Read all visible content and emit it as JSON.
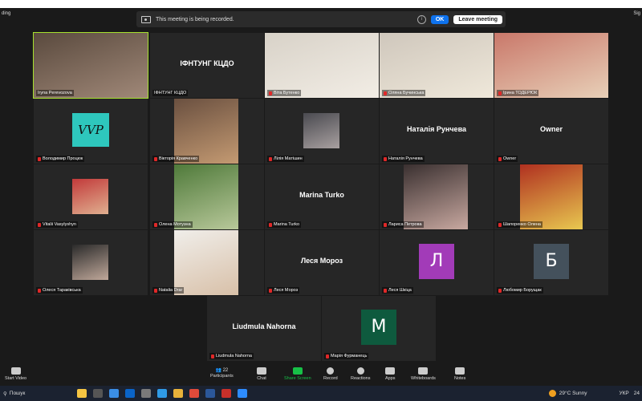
{
  "corner": {
    "left": "ding",
    "right": "Sig"
  },
  "recording": {
    "message": "This meeting is being recorded.",
    "ok": "OK",
    "leave": "Leave meeting"
  },
  "tiles": [
    {
      "name": "Iryna Perevozova",
      "big": "",
      "avatar": "",
      "type": "photo"
    },
    {
      "name": "ІФНТУНГ КЦДО",
      "big": "ІФНТУНГ КЦДО",
      "avatar": "",
      "type": "text"
    },
    {
      "name": "Віта Бутенко",
      "big": "",
      "avatar": "",
      "type": "photo"
    },
    {
      "name": "Оляна Бучинська",
      "big": "",
      "avatar": "",
      "type": "photo"
    },
    {
      "name": "Ірина ТОДЕРЮК",
      "big": "",
      "avatar": "",
      "type": "photo"
    },
    {
      "name": "Володимир Процюк",
      "big": "",
      "avatar": "VVP",
      "type": "logo"
    },
    {
      "name": "Вікторія Кравченко",
      "big": "",
      "avatar": "",
      "type": "photo"
    },
    {
      "name": "Лілія Матішин",
      "big": "",
      "avatar": "",
      "type": "smallphoto"
    },
    {
      "name": "Наталія Рунчева",
      "big": "Наталія Рунчева",
      "avatar": "",
      "type": "text"
    },
    {
      "name": "Owner",
      "big": "Owner",
      "avatar": "",
      "type": "text"
    },
    {
      "name": "Vitalii Vasylyshyn",
      "big": "",
      "avatar": "",
      "type": "smallphoto"
    },
    {
      "name": "Олена Мотузна",
      "big": "",
      "avatar": "",
      "type": "photo"
    },
    {
      "name": "Marina Turko",
      "big": "Marina Turko",
      "avatar": "",
      "type": "text"
    },
    {
      "name": "Лариса Петрова",
      "big": "",
      "avatar": "",
      "type": "photo"
    },
    {
      "name": "Шапоренко Олена",
      "big": "",
      "avatar": "",
      "type": "photo"
    },
    {
      "name": "Олеся Тараківська",
      "big": "",
      "avatar": "",
      "type": "smallphoto"
    },
    {
      "name": "Natalia Drar",
      "big": "",
      "avatar": "",
      "type": "photo"
    },
    {
      "name": "Леся Мороз",
      "big": "Леся Мороз",
      "avatar": "",
      "type": "text"
    },
    {
      "name": "Леся Шкіца",
      "big": "",
      "avatar": "Л",
      "type": "letter",
      "color": "#a23bb8"
    },
    {
      "name": "Любомир Борущак",
      "big": "",
      "avatar": "Б",
      "type": "letter",
      "color": "#44515c"
    },
    {
      "name": "Liudmula Nahorna",
      "big": "Liudmula Nahorna",
      "avatar": "",
      "type": "text"
    },
    {
      "name": "Марія Фурманець",
      "big": "",
      "avatar": "М",
      "type": "letter",
      "color": "#0e5a3e"
    }
  ],
  "toolbar": {
    "start_video": "Start Video",
    "participants": "Participants",
    "participants_count": "22",
    "chat": "Chat",
    "share": "Share Screen",
    "record": "Record",
    "reactions": "Reactions",
    "apps": "Apps",
    "whiteboards": "Whiteboards",
    "notes": "Notes"
  },
  "taskbar": {
    "search": "Пошук",
    "weather": "29°C Sunny",
    "lang": "УКР",
    "time": "24"
  },
  "colors": {
    "accent": "#0e72ed",
    "share": "#17c147",
    "active": "#a6e22e"
  }
}
